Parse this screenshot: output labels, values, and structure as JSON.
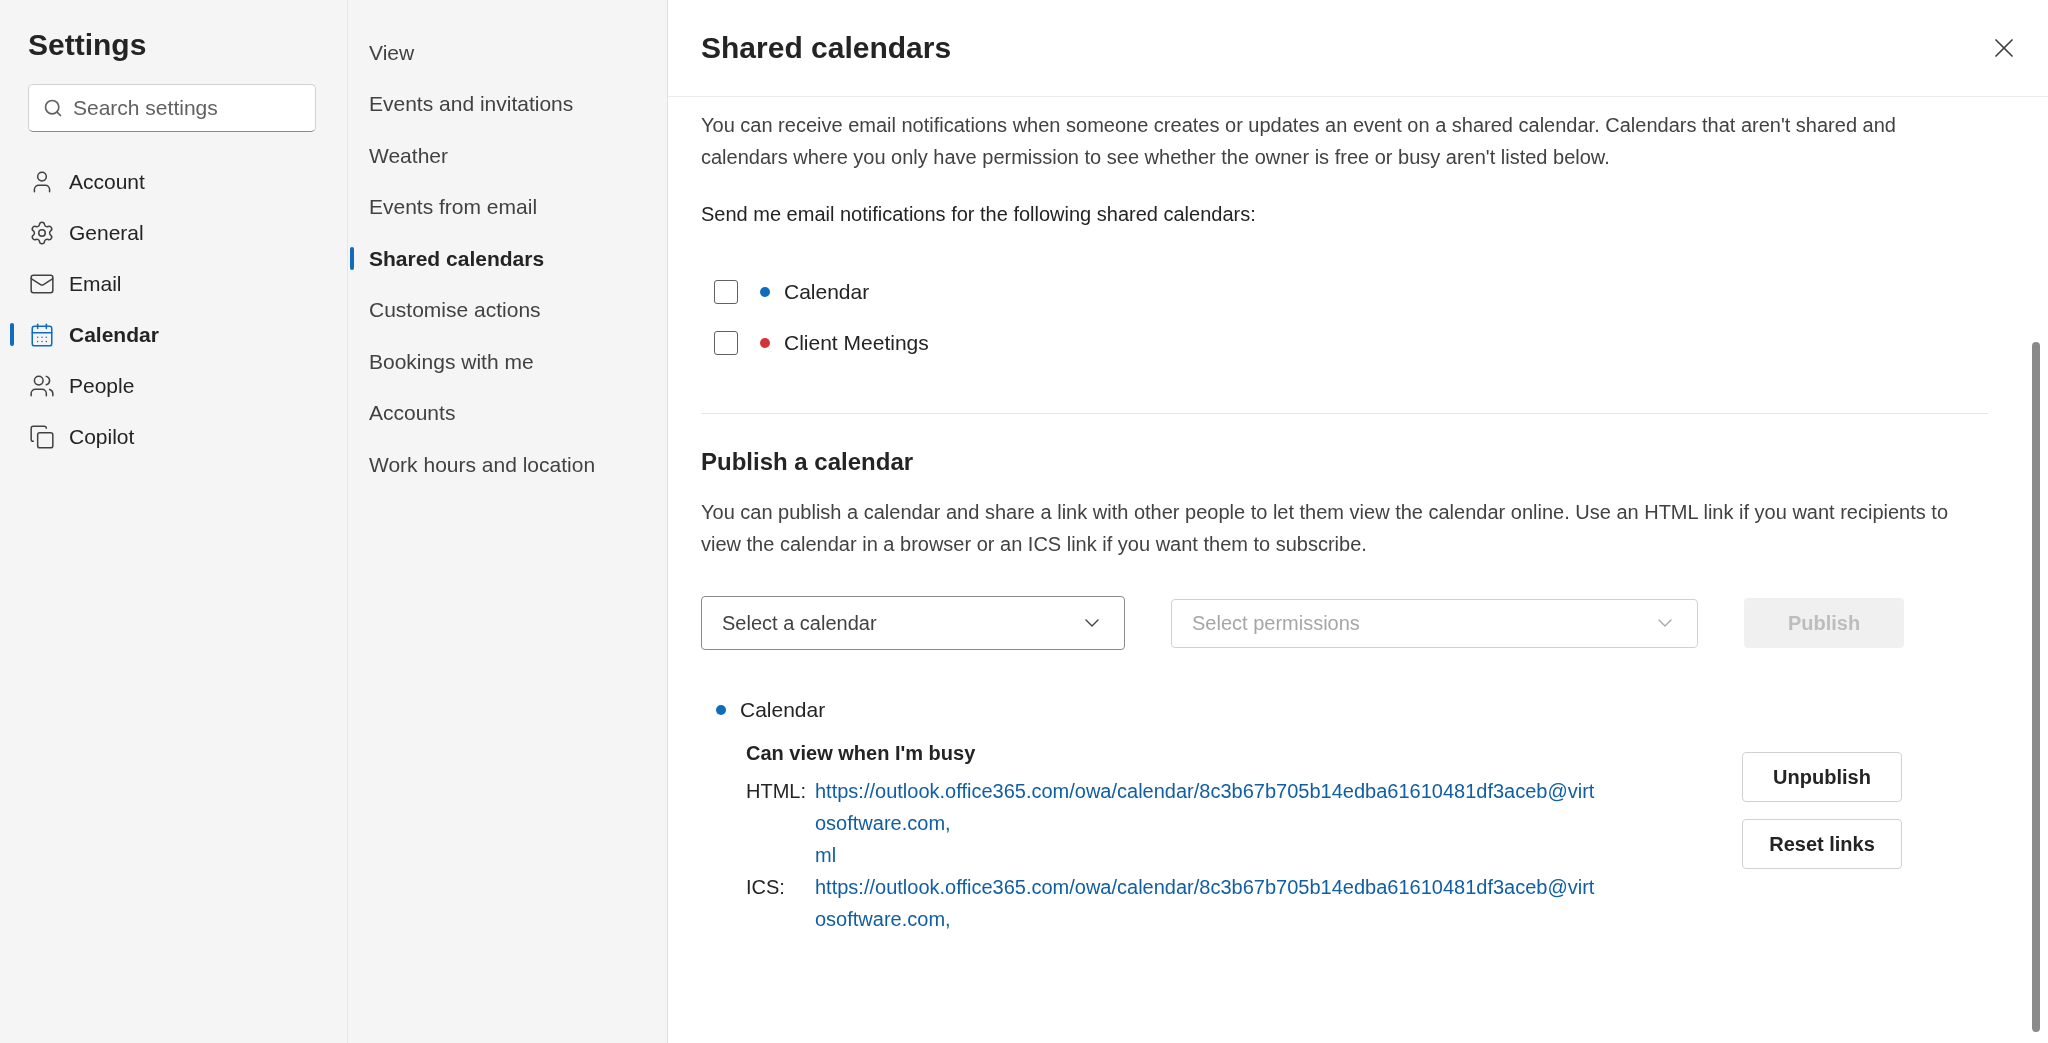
{
  "sidebar": {
    "title": "Settings",
    "search": {
      "placeholder": "Search settings"
    },
    "items": [
      {
        "label": "Account",
        "selected": false
      },
      {
        "label": "General",
        "selected": false
      },
      {
        "label": "Email",
        "selected": false
      },
      {
        "label": "Calendar",
        "selected": true
      },
      {
        "label": "People",
        "selected": false
      },
      {
        "label": "Copilot",
        "selected": false
      }
    ]
  },
  "subnav": {
    "items": [
      {
        "label": "View",
        "selected": false
      },
      {
        "label": "Events and invitations",
        "selected": false
      },
      {
        "label": "Weather",
        "selected": false
      },
      {
        "label": "Events from email",
        "selected": false
      },
      {
        "label": "Shared calendars",
        "selected": true
      },
      {
        "label": "Customise actions",
        "selected": false
      },
      {
        "label": "Bookings with me",
        "selected": false
      },
      {
        "label": "Accounts",
        "selected": false
      },
      {
        "label": "Work hours and location",
        "selected": false
      }
    ]
  },
  "panel": {
    "title": "Shared calendars",
    "intro": "You can receive email notifications when someone creates or updates an event on a shared calendar. Calendars that aren't shared and calendars where you only have permission to see whether the owner is free or busy aren't listed below.",
    "notify_label": "Send me email notifications for the following shared calendars:",
    "calendars": [
      {
        "name": "Calendar",
        "checked": false,
        "color": "#0f6cbd"
      },
      {
        "name": "Client Meetings",
        "checked": false,
        "color": "#d13438"
      }
    ],
    "publish": {
      "heading": "Publish a calendar",
      "description": "You can publish a calendar and share a link with other people to let them view the calendar online. Use an HTML link if you want recipients to view the calendar in a browser or an ICS link if you want them to subscribe.",
      "calendar_select": {
        "placeholder": "Select a calendar",
        "disabled": false
      },
      "permissions_select": {
        "placeholder": "Select permissions",
        "disabled": true
      },
      "publish_button": {
        "label": "Publish",
        "disabled": true
      },
      "published": [
        {
          "name": "Calendar",
          "color": "#0f6cbd",
          "permission": "Can view when I'm busy",
          "links": [
            {
              "label": "HTML:",
              "lines": [
                "https://outlook.office365.com/owa/calendar/8c3b67b705b14edba61610481df3aceb@virt",
                "osoftware.com,",
                "ml"
              ]
            },
            {
              "label": "ICS:",
              "lines": [
                "https://outlook.office365.com/owa/calendar/8c3b67b705b14edba61610481df3aceb@virt",
                "osoftware.com,"
              ]
            }
          ],
          "buttons": [
            "Unpublish",
            "Reset links"
          ]
        }
      ]
    }
  }
}
